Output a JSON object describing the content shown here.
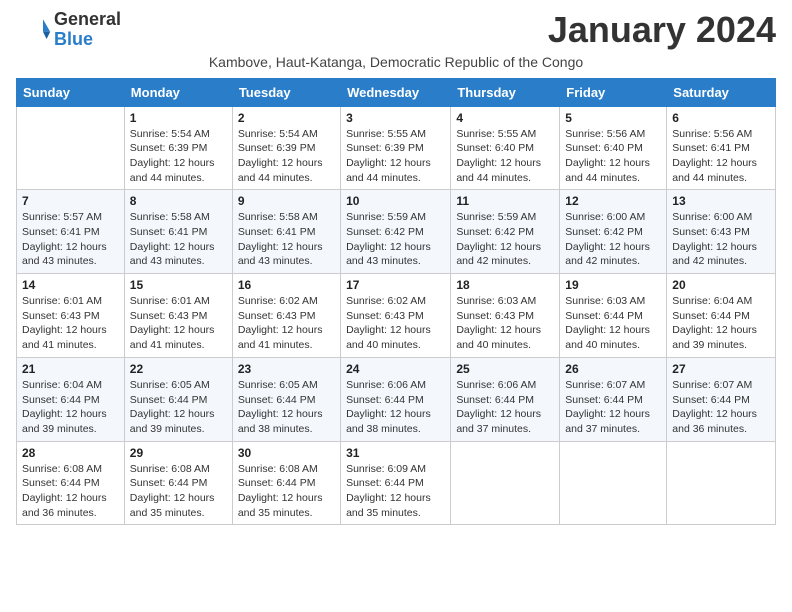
{
  "logo": {
    "general": "General",
    "blue": "Blue"
  },
  "header": {
    "month_title": "January 2024",
    "subtitle": "Kambove, Haut-Katanga, Democratic Republic of the Congo"
  },
  "days_of_week": [
    "Sunday",
    "Monday",
    "Tuesday",
    "Wednesday",
    "Thursday",
    "Friday",
    "Saturday"
  ],
  "weeks": [
    [
      {
        "day": "",
        "info": ""
      },
      {
        "day": "1",
        "info": "Sunrise: 5:54 AM\nSunset: 6:39 PM\nDaylight: 12 hours\nand 44 minutes."
      },
      {
        "day": "2",
        "info": "Sunrise: 5:54 AM\nSunset: 6:39 PM\nDaylight: 12 hours\nand 44 minutes."
      },
      {
        "day": "3",
        "info": "Sunrise: 5:55 AM\nSunset: 6:39 PM\nDaylight: 12 hours\nand 44 minutes."
      },
      {
        "day": "4",
        "info": "Sunrise: 5:55 AM\nSunset: 6:40 PM\nDaylight: 12 hours\nand 44 minutes."
      },
      {
        "day": "5",
        "info": "Sunrise: 5:56 AM\nSunset: 6:40 PM\nDaylight: 12 hours\nand 44 minutes."
      },
      {
        "day": "6",
        "info": "Sunrise: 5:56 AM\nSunset: 6:41 PM\nDaylight: 12 hours\nand 44 minutes."
      }
    ],
    [
      {
        "day": "7",
        "info": "Sunrise: 5:57 AM\nSunset: 6:41 PM\nDaylight: 12 hours\nand 43 minutes."
      },
      {
        "day": "8",
        "info": "Sunrise: 5:58 AM\nSunset: 6:41 PM\nDaylight: 12 hours\nand 43 minutes."
      },
      {
        "day": "9",
        "info": "Sunrise: 5:58 AM\nSunset: 6:41 PM\nDaylight: 12 hours\nand 43 minutes."
      },
      {
        "day": "10",
        "info": "Sunrise: 5:59 AM\nSunset: 6:42 PM\nDaylight: 12 hours\nand 43 minutes."
      },
      {
        "day": "11",
        "info": "Sunrise: 5:59 AM\nSunset: 6:42 PM\nDaylight: 12 hours\nand 42 minutes."
      },
      {
        "day": "12",
        "info": "Sunrise: 6:00 AM\nSunset: 6:42 PM\nDaylight: 12 hours\nand 42 minutes."
      },
      {
        "day": "13",
        "info": "Sunrise: 6:00 AM\nSunset: 6:43 PM\nDaylight: 12 hours\nand 42 minutes."
      }
    ],
    [
      {
        "day": "14",
        "info": "Sunrise: 6:01 AM\nSunset: 6:43 PM\nDaylight: 12 hours\nand 41 minutes."
      },
      {
        "day": "15",
        "info": "Sunrise: 6:01 AM\nSunset: 6:43 PM\nDaylight: 12 hours\nand 41 minutes."
      },
      {
        "day": "16",
        "info": "Sunrise: 6:02 AM\nSunset: 6:43 PM\nDaylight: 12 hours\nand 41 minutes."
      },
      {
        "day": "17",
        "info": "Sunrise: 6:02 AM\nSunset: 6:43 PM\nDaylight: 12 hours\nand 40 minutes."
      },
      {
        "day": "18",
        "info": "Sunrise: 6:03 AM\nSunset: 6:43 PM\nDaylight: 12 hours\nand 40 minutes."
      },
      {
        "day": "19",
        "info": "Sunrise: 6:03 AM\nSunset: 6:44 PM\nDaylight: 12 hours\nand 40 minutes."
      },
      {
        "day": "20",
        "info": "Sunrise: 6:04 AM\nSunset: 6:44 PM\nDaylight: 12 hours\nand 39 minutes."
      }
    ],
    [
      {
        "day": "21",
        "info": "Sunrise: 6:04 AM\nSunset: 6:44 PM\nDaylight: 12 hours\nand 39 minutes."
      },
      {
        "day": "22",
        "info": "Sunrise: 6:05 AM\nSunset: 6:44 PM\nDaylight: 12 hours\nand 39 minutes."
      },
      {
        "day": "23",
        "info": "Sunrise: 6:05 AM\nSunset: 6:44 PM\nDaylight: 12 hours\nand 38 minutes."
      },
      {
        "day": "24",
        "info": "Sunrise: 6:06 AM\nSunset: 6:44 PM\nDaylight: 12 hours\nand 38 minutes."
      },
      {
        "day": "25",
        "info": "Sunrise: 6:06 AM\nSunset: 6:44 PM\nDaylight: 12 hours\nand 37 minutes."
      },
      {
        "day": "26",
        "info": "Sunrise: 6:07 AM\nSunset: 6:44 PM\nDaylight: 12 hours\nand 37 minutes."
      },
      {
        "day": "27",
        "info": "Sunrise: 6:07 AM\nSunset: 6:44 PM\nDaylight: 12 hours\nand 36 minutes."
      }
    ],
    [
      {
        "day": "28",
        "info": "Sunrise: 6:08 AM\nSunset: 6:44 PM\nDaylight: 12 hours\nand 36 minutes."
      },
      {
        "day": "29",
        "info": "Sunrise: 6:08 AM\nSunset: 6:44 PM\nDaylight: 12 hours\nand 35 minutes."
      },
      {
        "day": "30",
        "info": "Sunrise: 6:08 AM\nSunset: 6:44 PM\nDaylight: 12 hours\nand 35 minutes."
      },
      {
        "day": "31",
        "info": "Sunrise: 6:09 AM\nSunset: 6:44 PM\nDaylight: 12 hours\nand 35 minutes."
      },
      {
        "day": "",
        "info": ""
      },
      {
        "day": "",
        "info": ""
      },
      {
        "day": "",
        "info": ""
      }
    ]
  ]
}
